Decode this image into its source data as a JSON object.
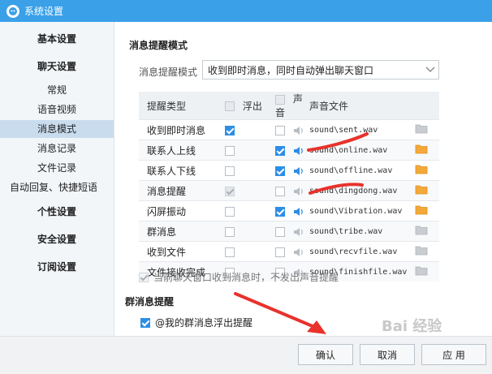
{
  "window": {
    "title": "系统设置"
  },
  "sidebar": {
    "items": [
      {
        "label": "基本设置",
        "group": true,
        "active": false
      },
      {
        "label": "聊天设置",
        "group": true,
        "active": false
      },
      {
        "label": "常规",
        "group": false,
        "active": false
      },
      {
        "label": "语音视频",
        "group": false,
        "active": false
      },
      {
        "label": "消息模式",
        "group": false,
        "active": true
      },
      {
        "label": "消息记录",
        "group": false,
        "active": false
      },
      {
        "label": "文件记录",
        "group": false,
        "active": false
      },
      {
        "label": "自动回复、快捷短语",
        "group": false,
        "active": false
      },
      {
        "label": "个性设置",
        "group": true,
        "active": false
      },
      {
        "label": "安全设置",
        "group": true,
        "active": false
      },
      {
        "label": "订阅设置",
        "group": true,
        "active": false
      }
    ]
  },
  "main": {
    "section_title": "消息提醒模式",
    "mode_label": "消息提醒模式",
    "mode_value": "收到即时消息，同时自动弹出聊天窗口",
    "table": {
      "headers": {
        "type": "提醒类型",
        "popup": "浮出",
        "sound": "声音",
        "file": "声音文件"
      },
      "rows": [
        {
          "name": "收到即时消息",
          "popup": "checked",
          "sound": "unchecked",
          "file": "sound\\sent.wav",
          "folder": "gray"
        },
        {
          "name": "联系人上线",
          "popup": "unchecked",
          "sound": "checked",
          "file": "sound\\online.wav",
          "folder": "orange"
        },
        {
          "name": "联系人下线",
          "popup": "unchecked",
          "sound": "checked",
          "file": "sound\\offline.wav",
          "folder": "orange"
        },
        {
          "name": "消息提醒",
          "popup": "disabled",
          "sound": "unchecked",
          "file": "sound\\dingdong.wav",
          "folder": "orange"
        },
        {
          "name": "闪屏振动",
          "popup": "unchecked",
          "sound": "checked",
          "file": "sound\\Vibration.wav",
          "folder": "orange"
        },
        {
          "name": "群消息",
          "popup": "unchecked",
          "sound": "unchecked",
          "file": "sound\\tribe.wav",
          "folder": "gray"
        },
        {
          "name": "收到文件",
          "popup": "unchecked",
          "sound": "unchecked",
          "file": "sound\\recvfile.wav",
          "folder": "gray"
        },
        {
          "name": "文件接收完成",
          "popup": "unchecked",
          "sound": "unchecked",
          "file": "sound\\finishfile.wav",
          "folder": "gray"
        }
      ]
    },
    "note": "当前聊天窗口收到消息时，不发出声音提醒",
    "group_section_title": "群消息提醒",
    "group_option": "@我的群消息浮出提醒",
    "group_option_checked": true
  },
  "footer": {
    "ok": "确认",
    "cancel": "取消",
    "apply": "应 用"
  },
  "colors": {
    "titlebar": "#3aa0e8",
    "accent": "#2d8ee6",
    "annotation": "#e8322b"
  },
  "watermark": "Bai 经验"
}
